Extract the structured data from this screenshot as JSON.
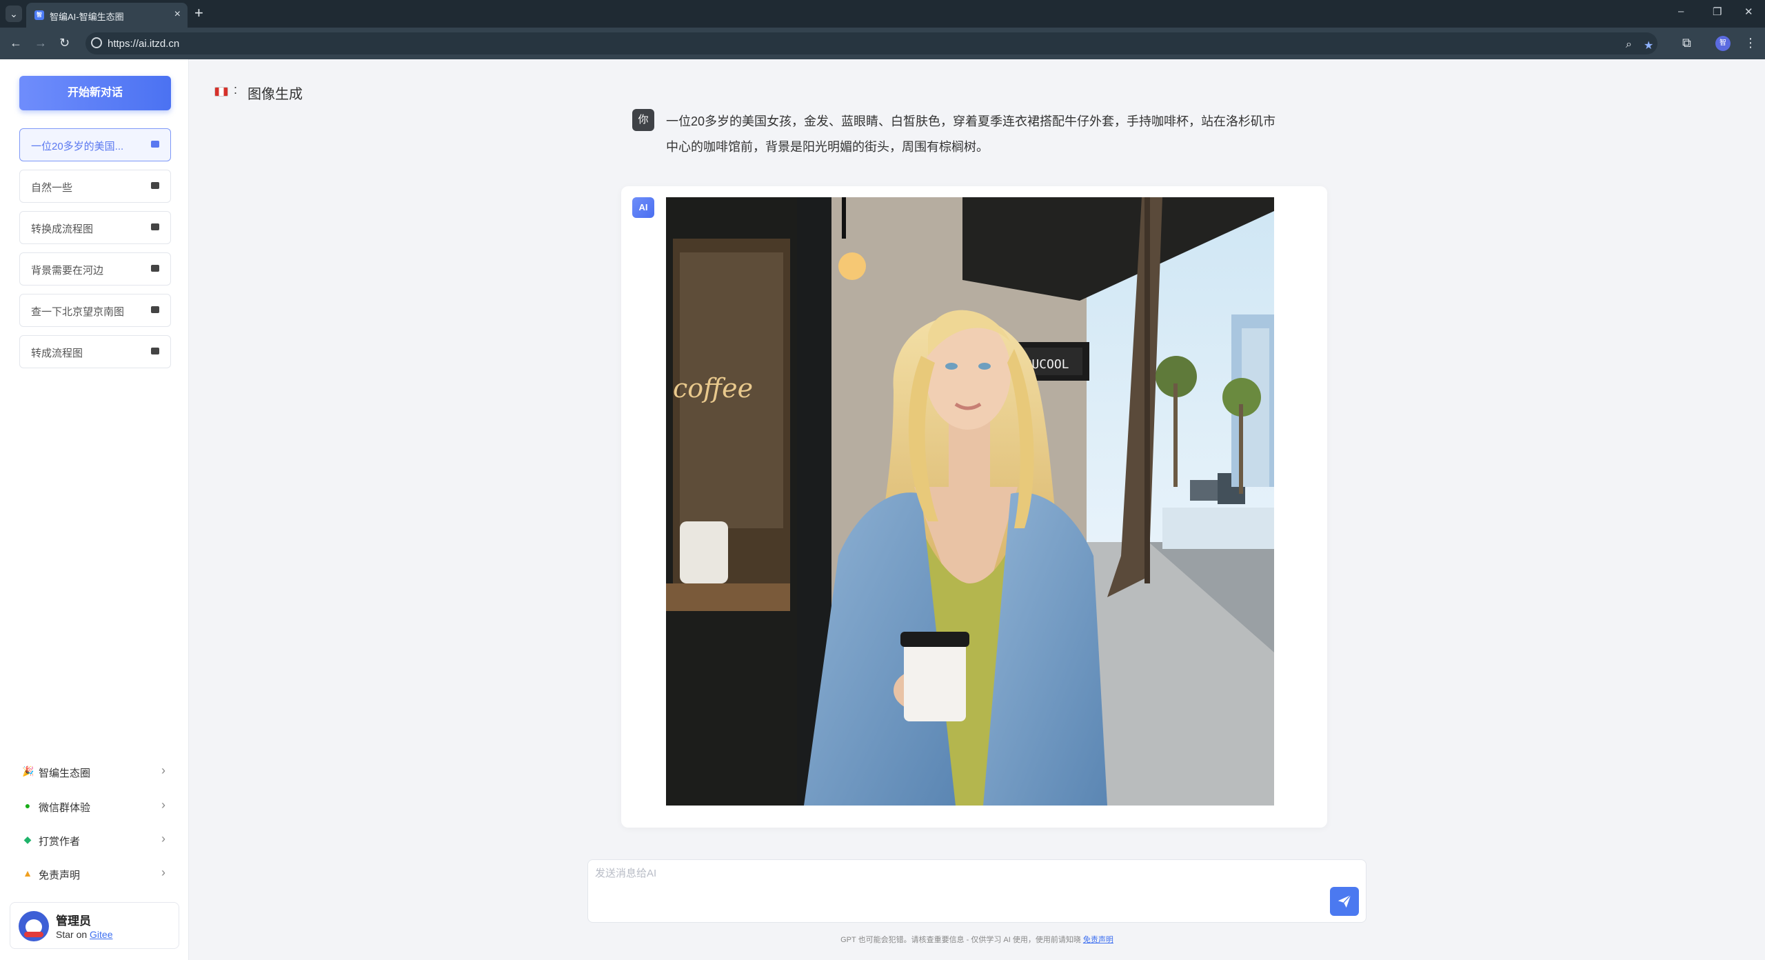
{
  "browser": {
    "tab_title": "智编AI-智编生态圈",
    "tab_favicon_text": "智",
    "url": "https://ai.itzd.cn",
    "profile_initial": "智"
  },
  "sidebar": {
    "new_chat_label": "开始新对话",
    "conversations": [
      {
        "label": "一位20多岁的美国...",
        "active": true
      },
      {
        "label": "自然一些",
        "active": false
      },
      {
        "label": "转换成流程图",
        "active": false
      },
      {
        "label": "背景需要在河边",
        "active": false
      },
      {
        "label": "查一下北京望京南图",
        "active": false
      },
      {
        "label": "转成流程图",
        "active": false
      }
    ],
    "links": [
      {
        "label": "智编生态圈",
        "icon": "party-popper-icon"
      },
      {
        "label": "微信群体验",
        "icon": "wechat-icon"
      },
      {
        "label": "打赏作者",
        "icon": "diamond-icon"
      },
      {
        "label": "免责声明",
        "icon": "warning-icon"
      }
    ],
    "user": {
      "name": "管理员",
      "star_prefix": "Star on ",
      "star_link": "Gitee"
    }
  },
  "main": {
    "mode_label": "图像生成",
    "mode_sep": ":",
    "user_badge": "你",
    "user_message": "一位20多岁的美国女孩，金发、蓝眼睛、白皙肤色，穿着夏季连衣裙搭配牛仔外套，手持咖啡杯，站在洛杉矶市中心的咖啡馆前，背景是阳光明媚的街头，周围有棕榈树。",
    "ai_badge": "AI",
    "image_sign_text": "PUCOOL",
    "image_window_text": "coffee",
    "input_placeholder": "发送消息给AI",
    "footer_text": "GPT 也可能会犯错。请核查重要信息 - 仅供学习 AI 使用，使用前请知晓 ",
    "footer_link": "免责声明"
  },
  "colors": {
    "accent": "#4b72f2",
    "sidebar_bg": "#ffffff",
    "main_bg": "#f3f4f7"
  }
}
